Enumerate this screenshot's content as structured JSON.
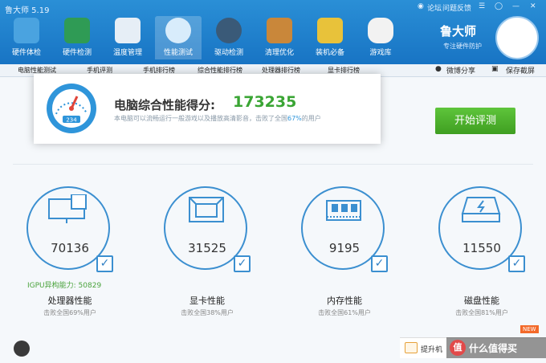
{
  "app": {
    "title": "鲁大师 5.19"
  },
  "window_controls": {
    "forum": "论坛",
    "feedback": "问题反馈"
  },
  "nav": [
    {
      "label": "硬件体检",
      "icon": "monitor-icon"
    },
    {
      "label": "硬件检测",
      "icon": "circuit-board-icon"
    },
    {
      "label": "温度管理",
      "icon": "thermometer-icon"
    },
    {
      "label": "性能测试",
      "icon": "speedometer-icon"
    },
    {
      "label": "驱动检测",
      "icon": "gear-shield-icon"
    },
    {
      "label": "清理优化",
      "icon": "broom-icon"
    },
    {
      "label": "装机必备",
      "icon": "package-box-icon"
    },
    {
      "label": "游戏库",
      "icon": "gamepad-icon"
    }
  ],
  "brand": {
    "name": "鲁大师",
    "slogan": "专注硬件防护"
  },
  "tabs": [
    "电脑性能测试",
    "手机评测",
    "手机排行榜",
    "综合性能排行榜",
    "处理器排行榜",
    "显卡排行榜"
  ],
  "actions": {
    "weibo_share": "微博分享",
    "save_screenshot": "保存截屏"
  },
  "score": {
    "label": "电脑综合性能得分:",
    "value": "173235",
    "desc_prefix": "本电脑可以流畅运行一般游戏以及播放高清影音，击败了全国",
    "desc_pct": "67%",
    "desc_suffix": "的用户",
    "gauge_readout": "234"
  },
  "start_button": "开始评测",
  "cards": [
    {
      "name": "处理器性能",
      "value": "70136",
      "sub": "击败全国69%用户",
      "icon": "cpu-monitor-icon"
    },
    {
      "name": "显卡性能",
      "value": "31525",
      "sub": "击败全国38%用户",
      "icon": "graphics-card-icon"
    },
    {
      "name": "内存性能",
      "value": "9195",
      "sub": "击败全国61%用户",
      "icon": "memory-chip-icon"
    },
    {
      "name": "磁盘性能",
      "value": "11550",
      "sub": "击败全国81%用户",
      "icon": "hard-disk-icon"
    }
  ],
  "igpu": "IGPU异构能力: 50829",
  "upgrade": {
    "label": "提升机",
    "badge": "NEW"
  },
  "watermark": {
    "text": "什么值得买",
    "logo_char": "值"
  },
  "colors": {
    "titlebar": "#1f82cf",
    "accent_green": "#3aa534",
    "ring_blue": "#3b8fd0",
    "link_blue": "#2f95da"
  }
}
